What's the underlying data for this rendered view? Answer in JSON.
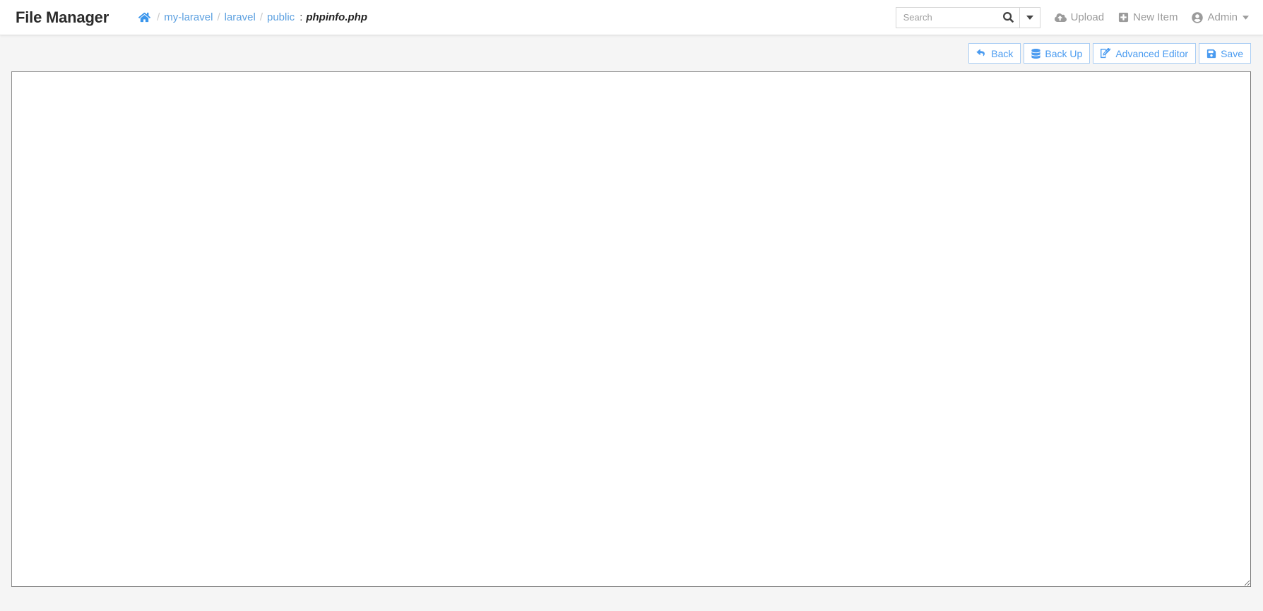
{
  "app": {
    "title": "File Manager"
  },
  "breadcrumb": {
    "home_icon": "home-icon",
    "separator": "/",
    "items": [
      {
        "label": "my-laravel"
      },
      {
        "label": "laravel"
      },
      {
        "label": "public"
      }
    ],
    "colon": ":",
    "current_file": "phpinfo.php"
  },
  "search": {
    "placeholder": "Search",
    "value": "",
    "icon": "search-icon",
    "caret_icon": "caret-down-icon"
  },
  "nav_actions": [
    {
      "label": "Upload",
      "icon": "cloud-upload-icon",
      "caret": false
    },
    {
      "label": "New Item",
      "icon": "plus-square-icon",
      "caret": false
    },
    {
      "label": "Admin",
      "icon": "user-circle-icon",
      "caret": true
    }
  ],
  "toolbar": {
    "back_label": "Back",
    "back_icon": "reply-arrow-icon",
    "backup_label": "Back Up",
    "backup_icon": "database-icon",
    "advanced_editor_label": "Advanced Editor",
    "advanced_editor_icon": "pencil-square-icon",
    "save_label": "Save",
    "save_icon": "floppy-save-icon"
  },
  "editor": {
    "content": "",
    "placeholder": ""
  },
  "colors": {
    "accent": "#4a9bf0",
    "link": "#5ca0e0",
    "muted": "#9b9b9b",
    "page_bg": "#f5f5f5",
    "navbar_bg": "#ffffff",
    "btn_border": "#a9cdf4"
  }
}
